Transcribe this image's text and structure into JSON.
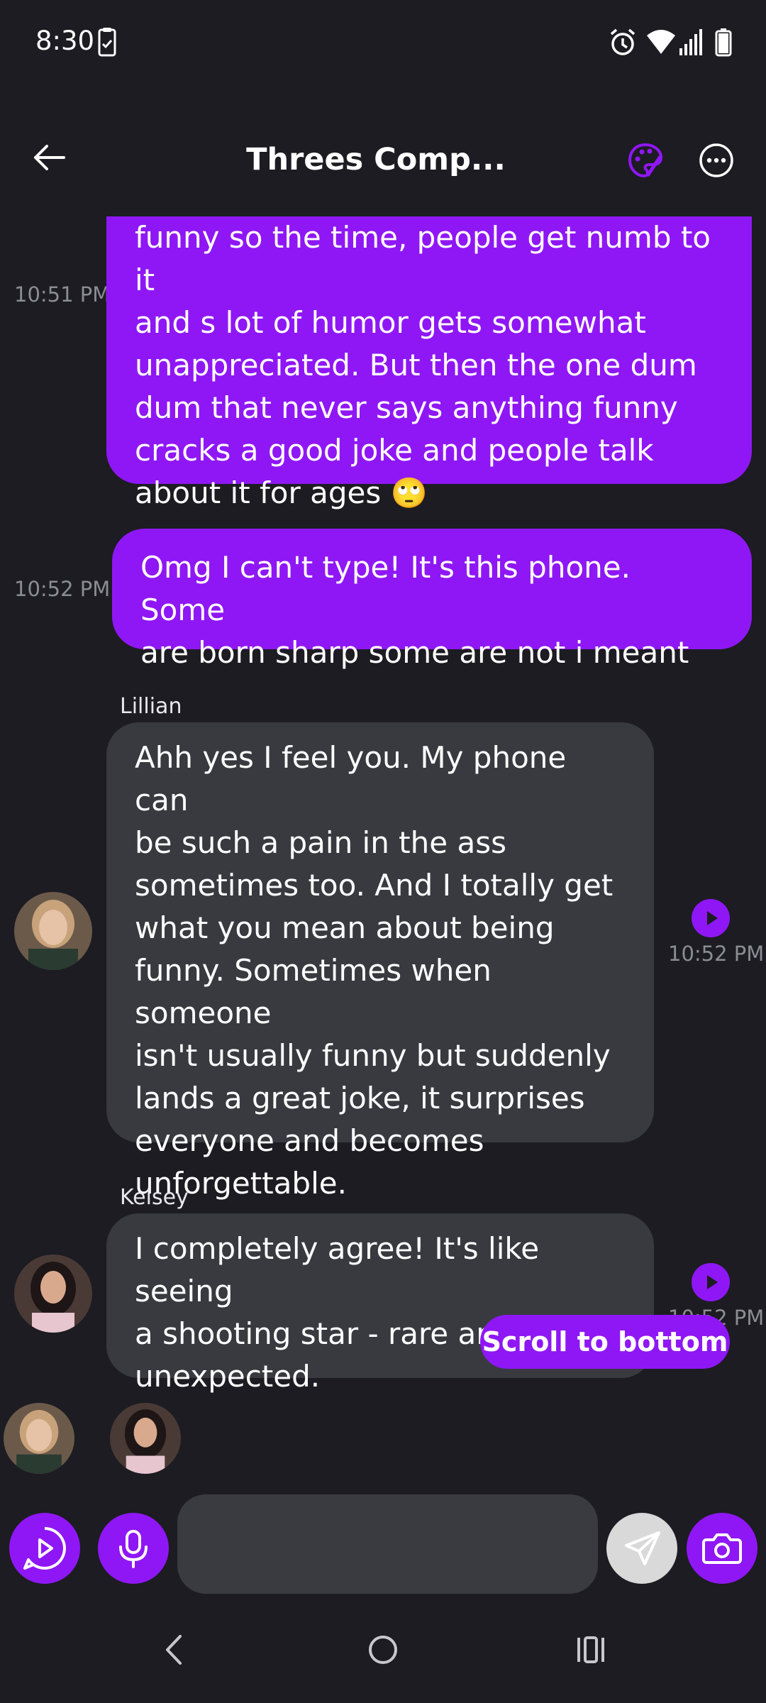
{
  "status_bar": {
    "time": "8:30",
    "icons": [
      "clipboard-check-icon",
      "alarm-icon",
      "wifi-icon",
      "signal-icon",
      "battery-icon"
    ]
  },
  "header": {
    "title": "Threes Comp...",
    "back_icon": "arrow-left-icon",
    "theme_icon": "palette-icon",
    "more_icon": "more-horizontal-icon"
  },
  "colors": {
    "accent": "#8f17f5",
    "background": "#1c1c22",
    "bubble_other": "#383a40",
    "timestamp": "#8c8c94"
  },
  "messages": [
    {
      "from": "me",
      "time": "10:51 PM",
      "lines": [
        "funny so the time, people get numb to it",
        "and s lot of humor gets somewhat",
        "unappreciated. But then the one dum",
        "dum that never says anything funny",
        "cracks a good joke and people talk",
        "about it for ages 🙄"
      ]
    },
    {
      "from": "me",
      "time": "10:52 PM",
      "lines": [
        "Omg I can't type! It's this phone. Some",
        "are born sharp some are not i meant"
      ]
    },
    {
      "from": "Lillian",
      "time": "10:52 PM",
      "lines": [
        "Ahh yes I feel you. My phone can",
        "be such a pain in the ass",
        "sometimes too. And I totally get",
        "what you mean about being",
        "funny. Sometimes when someone",
        "isn't usually funny but suddenly",
        "lands a great joke, it surprises",
        "everyone and becomes",
        "unforgettable."
      ]
    },
    {
      "from": "Kelsey",
      "time": "10:52 PM",
      "lines": [
        "I completely agree! It's like seeing",
        "a shooting star - rare and",
        "unexpected."
      ]
    }
  ],
  "scroll_to_bottom_label": "Scroll to bottom",
  "composer": {
    "input_value": "",
    "buttons": [
      "video-chat-icon",
      "microphone-icon",
      "send-icon",
      "camera-icon"
    ]
  },
  "nav_bar": {
    "icons": [
      "back-chevron-icon",
      "home-circle-icon",
      "recents-icon"
    ]
  }
}
